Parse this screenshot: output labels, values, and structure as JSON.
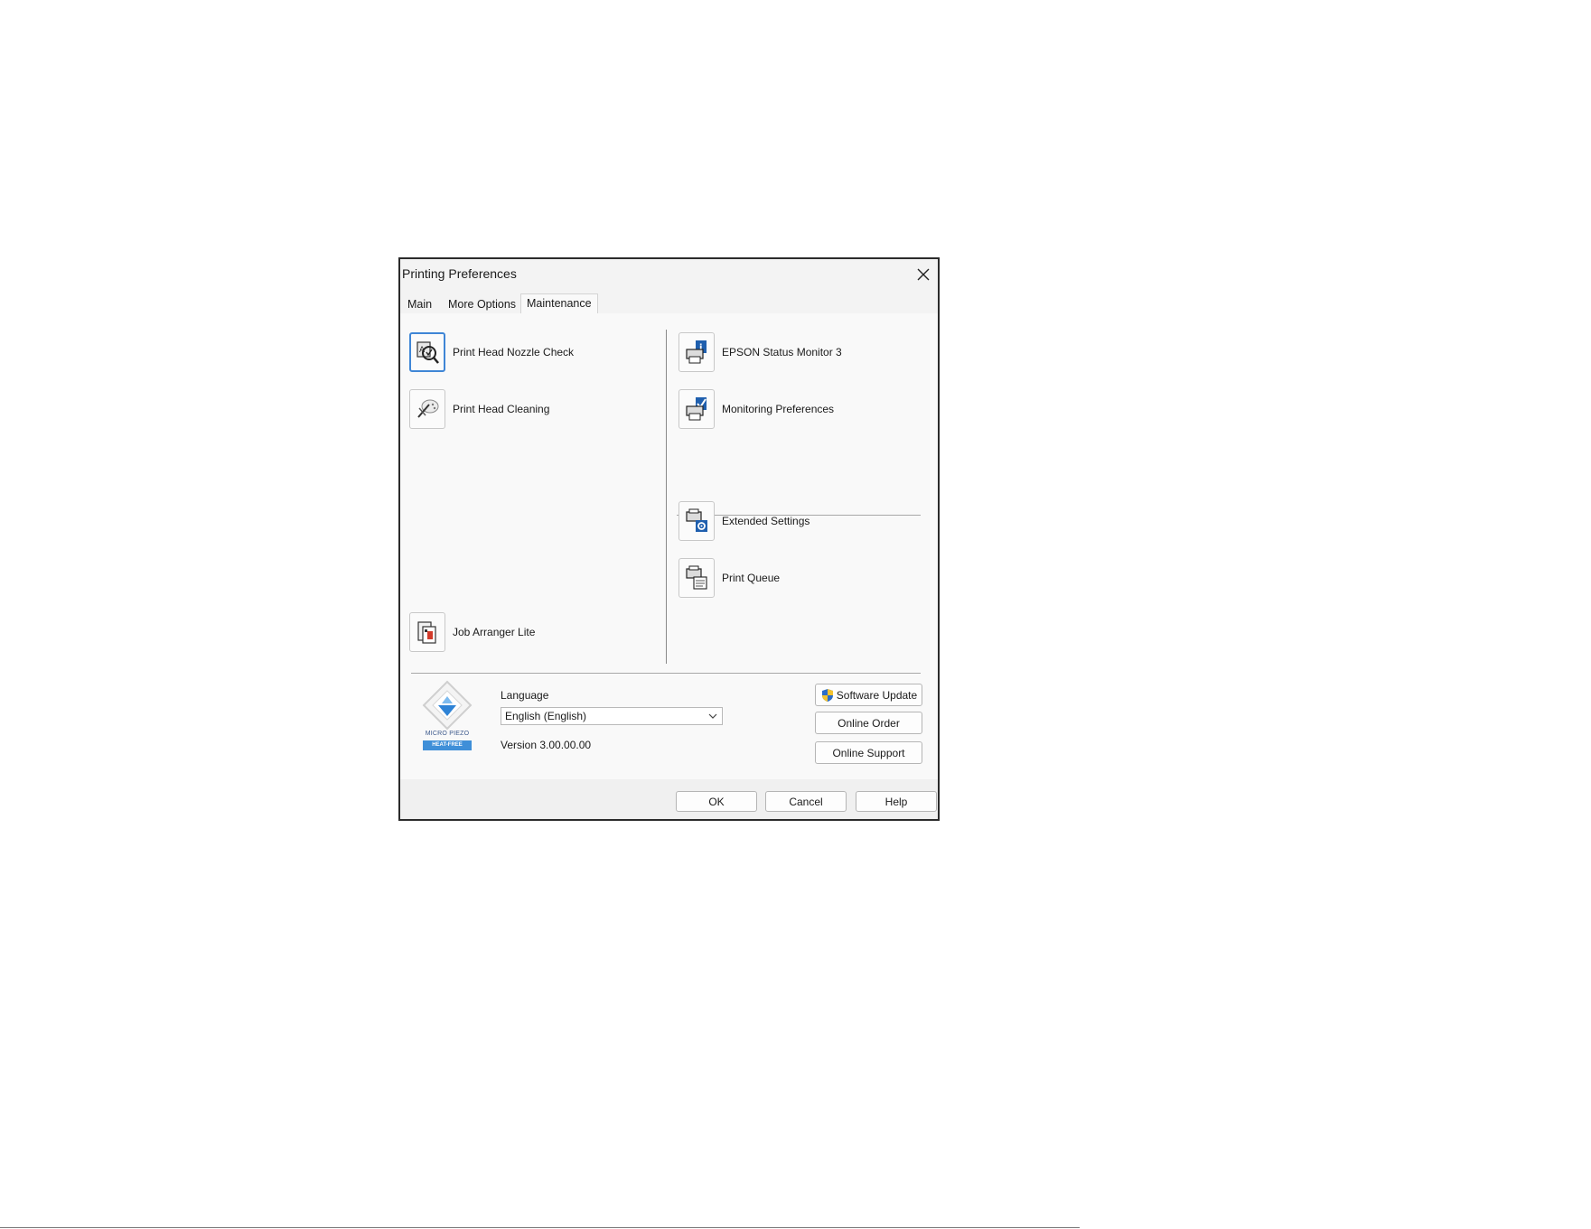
{
  "dialog": {
    "title": "Printing Preferences"
  },
  "tabs": [
    {
      "label": "Main",
      "active": false
    },
    {
      "label": "More Options",
      "active": false
    },
    {
      "label": "Maintenance",
      "active": true
    }
  ],
  "left_items": [
    {
      "label": "Print Head Nozzle Check",
      "icon": "nozzle-check-icon"
    },
    {
      "label": "Print Head Cleaning",
      "icon": "head-cleaning-icon"
    },
    {
      "label": "Job Arranger Lite",
      "icon": "job-arranger-icon"
    }
  ],
  "right_items": [
    {
      "label": "EPSON Status Monitor 3",
      "icon": "status-monitor-icon"
    },
    {
      "label": "Monitoring Preferences",
      "icon": "monitoring-preferences-icon"
    },
    {
      "label": "Extended Settings",
      "icon": "extended-settings-icon"
    },
    {
      "label": "Print Queue",
      "icon": "print-queue-icon"
    }
  ],
  "logo": {
    "line1": "MICRO PIEZO",
    "line2": "HEAT-FREE"
  },
  "language": {
    "label": "Language",
    "selected": "English (English)"
  },
  "version_text": "Version 3.00.00.00",
  "side_buttons": {
    "software_update": "Software Update",
    "online_order": "Online Order",
    "online_support": "Online Support"
  },
  "footer_buttons": {
    "ok": "OK",
    "cancel": "Cancel",
    "help": "Help"
  },
  "colors": {
    "focus_border": "#3f86d6",
    "brand_blue": "#3f8fd8"
  }
}
